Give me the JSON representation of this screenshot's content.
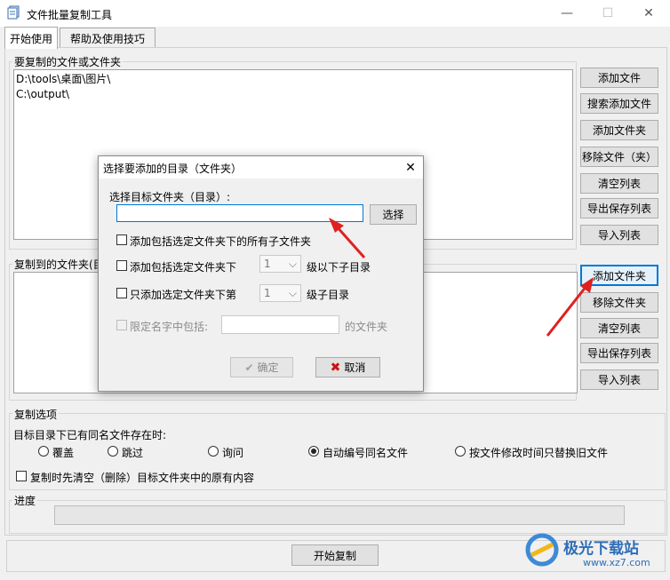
{
  "window": {
    "title": "文件批量复制工具"
  },
  "tabs": [
    {
      "label": "开始使用"
    },
    {
      "label": "帮助及使用技巧"
    }
  ],
  "source": {
    "group_label": "要复制的文件或文件夹",
    "items": [
      "D:\\tools\\桌面\\图片\\",
      "C:\\output\\"
    ],
    "buttons": [
      "添加文件",
      "搜索添加文件",
      "添加文件夹",
      "移除文件（夹）",
      "清空列表",
      "导出保存列表",
      "导入列表"
    ]
  },
  "target": {
    "group_label": "复制到的文件夹(目",
    "buttons": [
      "添加文件夹",
      "移除文件夹",
      "清空列表",
      "导出保存列表",
      "导入列表"
    ]
  },
  "options": {
    "group_label": "复制选项",
    "exists_label": "目标目录下已有同名文件存在时:",
    "radios": [
      {
        "label": "覆盖",
        "checked": false
      },
      {
        "label": "跳过",
        "checked": false
      },
      {
        "label": "询问",
        "checked": false
      },
      {
        "label": "自动编号同名文件",
        "checked": true
      },
      {
        "label": "按文件修改时间只替换旧文件",
        "checked": false
      }
    ],
    "clear_first_label": "复制时先清空（删除）目标文件夹中的原有内容"
  },
  "progress": {
    "label": "进度",
    "value": 0
  },
  "start_button": "开始复制",
  "dialog": {
    "title": "选择要添加的目录（文件夹）",
    "select_label": "选择目标文件夹（目录）:",
    "folder_input_value": "",
    "browse_button": "选择",
    "opt_all_subfolders": "添加包括选定文件夹下的所有子文件夹",
    "opt_levels_prefix": "添加包括选定文件夹下",
    "opt_levels_value": "1",
    "opt_levels_suffix": "级以下子目录",
    "opt_only_prefix": "只添加选定文件夹下第",
    "opt_only_value": "1",
    "opt_only_suffix": "级子目录",
    "name_filter_label": "限定名字中包括:",
    "name_filter_suffix": "的文件夹",
    "ok_button": "确定",
    "cancel_button": "取消"
  },
  "watermark": {
    "brand": "极光下载站",
    "url": "www.xz7.com"
  },
  "colors": {
    "accent": "#0078d7",
    "arrow": "#e02020",
    "cancel_icon": "#d01010"
  }
}
